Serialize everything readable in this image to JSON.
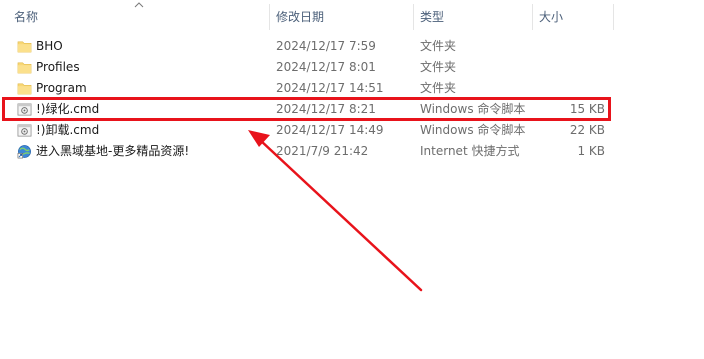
{
  "columns": {
    "name": "名称",
    "modified": "修改日期",
    "type": "类型",
    "size": "大小"
  },
  "files": [
    {
      "name": "BHO",
      "modified": "2024/12/17 7:59",
      "type": "文件夹",
      "size": "",
      "icon": "folder-icon"
    },
    {
      "name": "Profiles",
      "modified": "2024/12/17 8:01",
      "type": "文件夹",
      "size": "",
      "icon": "folder-icon"
    },
    {
      "name": "Program",
      "modified": "2024/12/17 14:51",
      "type": "文件夹",
      "size": "",
      "icon": "folder-icon"
    },
    {
      "name": "!)绿化.cmd",
      "modified": "2024/12/17 8:21",
      "type": "Windows 命令脚本",
      "size": "15 KB",
      "icon": "cmd-script-icon"
    },
    {
      "name": "!)卸载.cmd",
      "modified": "2024/12/17 14:49",
      "type": "Windows 命令脚本",
      "size": "22 KB",
      "icon": "cmd-script-icon"
    },
    {
      "name": "进入黑域基地-更多精品资源!",
      "modified": "2021/7/9 21:42",
      "type": "Internet 快捷方式",
      "size": "1 KB",
      "icon": "internet-shortcut-icon"
    }
  ],
  "colors": {
    "header_text": "#4c607a",
    "folder": "#f8d775",
    "annotation": "#e8131b"
  }
}
